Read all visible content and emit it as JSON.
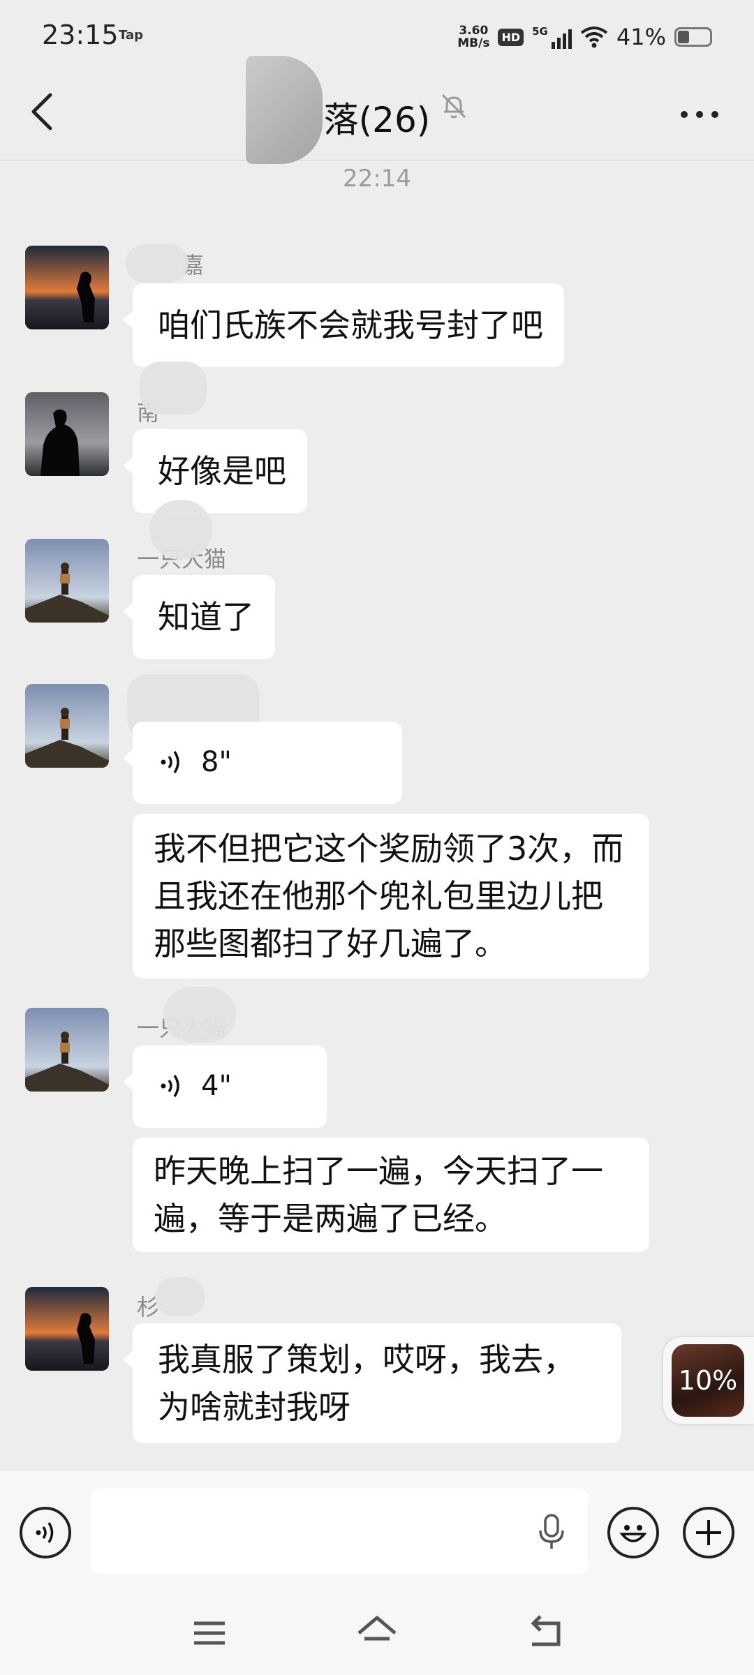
{
  "status_bar": {
    "time": "23:15",
    "tap_badge": "Tap",
    "net_speed_value": "3.60",
    "net_speed_unit": "MB/s",
    "hd_badge": "HD",
    "network": "5G",
    "battery": "41%",
    "battery_level": 0.41
  },
  "header": {
    "title": "落(26)",
    "back_icon": "chevron-left-icon",
    "mute_icon": "bell-off-icon",
    "more_icon": "more-icon"
  },
  "timestamp": "22:14",
  "messages": [
    {
      "sender": "嘉",
      "avatar": "sunset-silhouette-avatar",
      "type": "text",
      "text": "咱们氏族不会就我号封了吧"
    },
    {
      "sender": "南",
      "avatar": "dark-silhouette-avatar",
      "type": "text",
      "text": "好像是吧"
    },
    {
      "sender": "一只大猫",
      "avatar": "mountain-hiker-avatar",
      "type": "text",
      "text": "知道了"
    },
    {
      "sender": "",
      "avatar": "mountain-hiker-avatar",
      "type": "voice",
      "duration": "8\"",
      "transcript": "我不但把它这个奖励领了3次，而且我还在他那个兜礼包里边儿把那些图都扫了好几遍了。"
    },
    {
      "sender": "一只大猫",
      "avatar": "mountain-hiker-avatar",
      "type": "voice",
      "duration": "4\"",
      "transcript": "昨天晚上扫了一遍，今天扫了一遍，等于是两遍了已经。"
    },
    {
      "sender": "杉",
      "avatar": "sunset-silhouette-avatar",
      "type": "text",
      "text": "我真服了策划，哎呀，我去，为啥就封我呀"
    }
  ],
  "float_badge": {
    "progress": "10%"
  },
  "input_bar": {
    "voice_icon": "voice-mode-icon",
    "mic_icon": "microphone-icon",
    "emoji_icon": "emoji-icon",
    "plus_icon": "plus-icon",
    "placeholder": ""
  },
  "nav_bar": {
    "menu_icon": "menu-icon",
    "home_icon": "home-icon",
    "back_icon": "back-icon"
  }
}
